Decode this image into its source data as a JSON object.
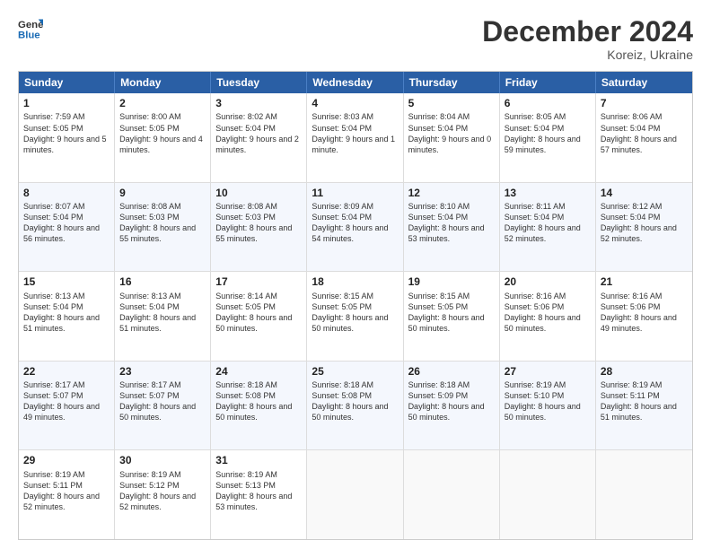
{
  "logo": {
    "line1": "General",
    "line2": "Blue"
  },
  "title": "December 2024",
  "subtitle": "Koreiz, Ukraine",
  "header_days": [
    "Sunday",
    "Monday",
    "Tuesday",
    "Wednesday",
    "Thursday",
    "Friday",
    "Saturday"
  ],
  "weeks": [
    [
      {
        "day": "1",
        "sunrise": "Sunrise: 7:59 AM",
        "sunset": "Sunset: 5:05 PM",
        "daylight": "Daylight: 9 hours and 5 minutes."
      },
      {
        "day": "2",
        "sunrise": "Sunrise: 8:00 AM",
        "sunset": "Sunset: 5:05 PM",
        "daylight": "Daylight: 9 hours and 4 minutes."
      },
      {
        "day": "3",
        "sunrise": "Sunrise: 8:02 AM",
        "sunset": "Sunset: 5:04 PM",
        "daylight": "Daylight: 9 hours and 2 minutes."
      },
      {
        "day": "4",
        "sunrise": "Sunrise: 8:03 AM",
        "sunset": "Sunset: 5:04 PM",
        "daylight": "Daylight: 9 hours and 1 minute."
      },
      {
        "day": "5",
        "sunrise": "Sunrise: 8:04 AM",
        "sunset": "Sunset: 5:04 PM",
        "daylight": "Daylight: 9 hours and 0 minutes."
      },
      {
        "day": "6",
        "sunrise": "Sunrise: 8:05 AM",
        "sunset": "Sunset: 5:04 PM",
        "daylight": "Daylight: 8 hours and 59 minutes."
      },
      {
        "day": "7",
        "sunrise": "Sunrise: 8:06 AM",
        "sunset": "Sunset: 5:04 PM",
        "daylight": "Daylight: 8 hours and 57 minutes."
      }
    ],
    [
      {
        "day": "8",
        "sunrise": "Sunrise: 8:07 AM",
        "sunset": "Sunset: 5:04 PM",
        "daylight": "Daylight: 8 hours and 56 minutes."
      },
      {
        "day": "9",
        "sunrise": "Sunrise: 8:08 AM",
        "sunset": "Sunset: 5:03 PM",
        "daylight": "Daylight: 8 hours and 55 minutes."
      },
      {
        "day": "10",
        "sunrise": "Sunrise: 8:08 AM",
        "sunset": "Sunset: 5:03 PM",
        "daylight": "Daylight: 8 hours and 55 minutes."
      },
      {
        "day": "11",
        "sunrise": "Sunrise: 8:09 AM",
        "sunset": "Sunset: 5:04 PM",
        "daylight": "Daylight: 8 hours and 54 minutes."
      },
      {
        "day": "12",
        "sunrise": "Sunrise: 8:10 AM",
        "sunset": "Sunset: 5:04 PM",
        "daylight": "Daylight: 8 hours and 53 minutes."
      },
      {
        "day": "13",
        "sunrise": "Sunrise: 8:11 AM",
        "sunset": "Sunset: 5:04 PM",
        "daylight": "Daylight: 8 hours and 52 minutes."
      },
      {
        "day": "14",
        "sunrise": "Sunrise: 8:12 AM",
        "sunset": "Sunset: 5:04 PM",
        "daylight": "Daylight: 8 hours and 52 minutes."
      }
    ],
    [
      {
        "day": "15",
        "sunrise": "Sunrise: 8:13 AM",
        "sunset": "Sunset: 5:04 PM",
        "daylight": "Daylight: 8 hours and 51 minutes."
      },
      {
        "day": "16",
        "sunrise": "Sunrise: 8:13 AM",
        "sunset": "Sunset: 5:04 PM",
        "daylight": "Daylight: 8 hours and 51 minutes."
      },
      {
        "day": "17",
        "sunrise": "Sunrise: 8:14 AM",
        "sunset": "Sunset: 5:05 PM",
        "daylight": "Daylight: 8 hours and 50 minutes."
      },
      {
        "day": "18",
        "sunrise": "Sunrise: 8:15 AM",
        "sunset": "Sunset: 5:05 PM",
        "daylight": "Daylight: 8 hours and 50 minutes."
      },
      {
        "day": "19",
        "sunrise": "Sunrise: 8:15 AM",
        "sunset": "Sunset: 5:05 PM",
        "daylight": "Daylight: 8 hours and 50 minutes."
      },
      {
        "day": "20",
        "sunrise": "Sunrise: 8:16 AM",
        "sunset": "Sunset: 5:06 PM",
        "daylight": "Daylight: 8 hours and 50 minutes."
      },
      {
        "day": "21",
        "sunrise": "Sunrise: 8:16 AM",
        "sunset": "Sunset: 5:06 PM",
        "daylight": "Daylight: 8 hours and 49 minutes."
      }
    ],
    [
      {
        "day": "22",
        "sunrise": "Sunrise: 8:17 AM",
        "sunset": "Sunset: 5:07 PM",
        "daylight": "Daylight: 8 hours and 49 minutes."
      },
      {
        "day": "23",
        "sunrise": "Sunrise: 8:17 AM",
        "sunset": "Sunset: 5:07 PM",
        "daylight": "Daylight: 8 hours and 50 minutes."
      },
      {
        "day": "24",
        "sunrise": "Sunrise: 8:18 AM",
        "sunset": "Sunset: 5:08 PM",
        "daylight": "Daylight: 8 hours and 50 minutes."
      },
      {
        "day": "25",
        "sunrise": "Sunrise: 8:18 AM",
        "sunset": "Sunset: 5:08 PM",
        "daylight": "Daylight: 8 hours and 50 minutes."
      },
      {
        "day": "26",
        "sunrise": "Sunrise: 8:18 AM",
        "sunset": "Sunset: 5:09 PM",
        "daylight": "Daylight: 8 hours and 50 minutes."
      },
      {
        "day": "27",
        "sunrise": "Sunrise: 8:19 AM",
        "sunset": "Sunset: 5:10 PM",
        "daylight": "Daylight: 8 hours and 50 minutes."
      },
      {
        "day": "28",
        "sunrise": "Sunrise: 8:19 AM",
        "sunset": "Sunset: 5:11 PM",
        "daylight": "Daylight: 8 hours and 51 minutes."
      }
    ],
    [
      {
        "day": "29",
        "sunrise": "Sunrise: 8:19 AM",
        "sunset": "Sunset: 5:11 PM",
        "daylight": "Daylight: 8 hours and 52 minutes."
      },
      {
        "day": "30",
        "sunrise": "Sunrise: 8:19 AM",
        "sunset": "Sunset: 5:12 PM",
        "daylight": "Daylight: 8 hours and 52 minutes."
      },
      {
        "day": "31",
        "sunrise": "Sunrise: 8:19 AM",
        "sunset": "Sunset: 5:13 PM",
        "daylight": "Daylight: 8 hours and 53 minutes."
      },
      {
        "day": "",
        "sunrise": "",
        "sunset": "",
        "daylight": ""
      },
      {
        "day": "",
        "sunrise": "",
        "sunset": "",
        "daylight": ""
      },
      {
        "day": "",
        "sunrise": "",
        "sunset": "",
        "daylight": ""
      },
      {
        "day": "",
        "sunrise": "",
        "sunset": "",
        "daylight": ""
      }
    ]
  ]
}
